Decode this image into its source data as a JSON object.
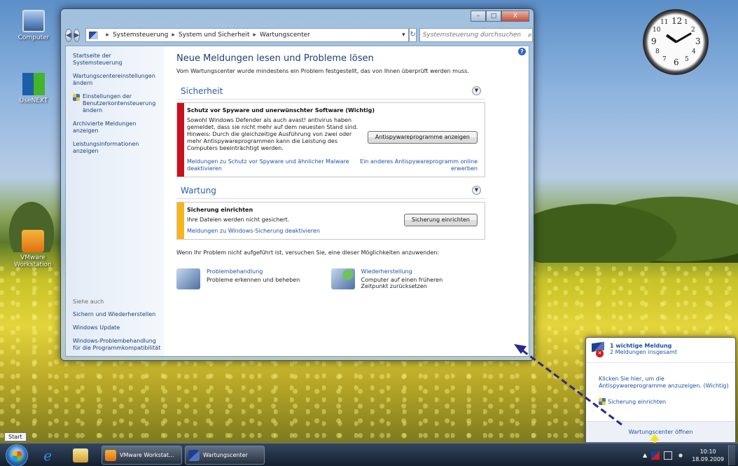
{
  "desktop": {
    "icons": [
      {
        "label": "Computer"
      },
      {
        "label": "UseNEXT"
      },
      {
        "label": "VMware Workstation"
      }
    ],
    "clock_numbers": [
      "12",
      "3",
      "6",
      "9",
      "1",
      "2",
      "4",
      "5",
      "7",
      "8",
      "10",
      "11"
    ]
  },
  "window": {
    "caption_buttons": {
      "minimize": "–",
      "maximize": "□",
      "close": "X"
    },
    "breadcrumb": [
      "Systemsteuerung",
      "System und Sicherheit",
      "Wartungscenter"
    ],
    "search_placeholder": "Systemsteuerung durchsuchen",
    "left_pane": {
      "links": [
        "Startseite der Systemsteuerung",
        "Wartungscentereinstellungen ändern",
        "Einstellungen der Benutzerkontensteuerung ändern",
        "Archivierte Meldungen anzeigen",
        "Leistungsinformationen anzeigen"
      ],
      "see_also_header": "Siehe auch",
      "see_also": [
        "Sichern und Wiederherstellen",
        "Windows Update",
        "Windows-Problembehandlung für die Programmkompatibilität"
      ]
    },
    "heading": "Neue Meldungen lesen und Probleme lösen",
    "intro": "Vom Wartungscenter wurde mindestens ein Problem festgestellt, das von Ihnen überprüft werden muss.",
    "security": {
      "title": "Sicherheit",
      "alert_title": "Schutz vor Spyware und unerwünschter Software  (Wichtig)",
      "alert_body": "Sowohl Windows Defender als auch avast! antivirus haben gemeldet, dass sie nicht mehr auf dem neuesten Stand sind. Hinweis: Durch die gleichzeitige Ausführung von zwei oder mehr Antispywareprogrammen kann die Leistung des Computers beeinträchtigt werden.",
      "button": "Antispywareprogramme anzeigen",
      "link_left": "Meldungen zu Schutz vor Spyware und ähnlicher Malware deaktivieren",
      "link_right": "Ein anderes Antispywareprogramm online erwerben"
    },
    "maintenance": {
      "title": "Wartung",
      "alert_title": "Sicherung einrichten",
      "alert_body": "Ihre Dateien werden nicht gesichert.",
      "button": "Sicherung einrichten",
      "link_left": "Meldungen zu Windows-Sicherung deaktivieren"
    },
    "try_text": "Wenn Ihr Problem nicht aufgeführt ist, versuchen Sie, eine dieser Möglichkeiten anzuwenden:",
    "tools": [
      {
        "title": "Problembehandlung",
        "desc": "Probleme erkennen und beheben"
      },
      {
        "title": "Wiederherstellung",
        "desc": "Computer auf einen früheren Zeitpunkt zurücksetzen"
      }
    ]
  },
  "flyout": {
    "headline": "1 wichtige Meldung",
    "subline": "2 Meldungen insgesamt",
    "message": "Klicken Sie hier, um die Antispywareprogramme anzuzeigen. (Wichtig)",
    "backup": "Sicherung einrichten",
    "footer": "Wartungscenter öffnen"
  },
  "taskbar": {
    "start_tooltip": "Start",
    "buttons": [
      "VMware Workstat...",
      "Wartungscenter"
    ],
    "time": "10:10",
    "date": "18.09.2009"
  },
  "colors": {
    "security_bar": "#c8101e",
    "maintenance_bar": "#f5b51c",
    "annotation_arrow": "#2b2a8a",
    "tray_arrow": "#f5e21a"
  }
}
